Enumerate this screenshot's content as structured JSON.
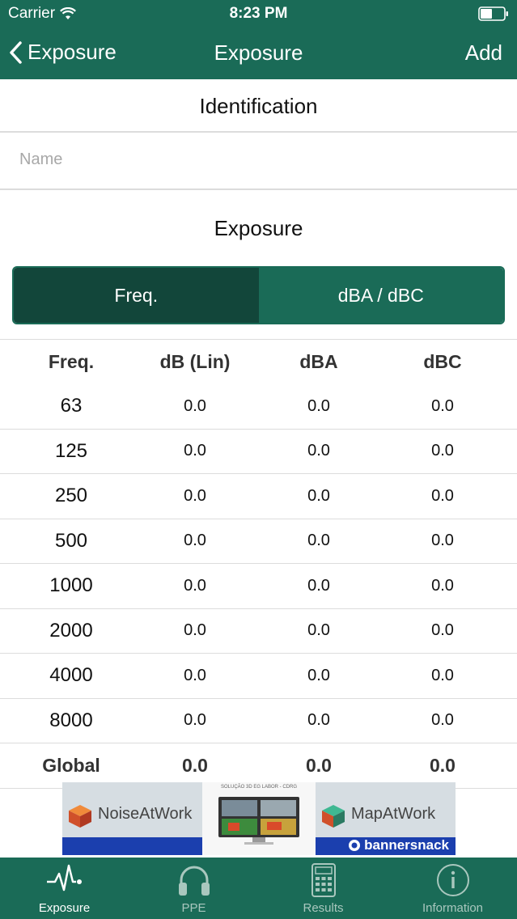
{
  "status_bar": {
    "carrier": "Carrier",
    "time": "8:23 PM"
  },
  "nav": {
    "back_label": "Exposure",
    "title": "Exposure",
    "add_label": "Add"
  },
  "identification": {
    "title": "Identification",
    "name_placeholder": "Name",
    "name_value": ""
  },
  "exposure": {
    "title": "Exposure",
    "segments": [
      {
        "label": "Freq.",
        "selected": true
      },
      {
        "label": "dBA / dBC",
        "selected": false
      }
    ]
  },
  "table": {
    "headers": [
      "Freq.",
      "dB (Lin)",
      "dBA",
      "dBC"
    ],
    "rows": [
      [
        "63",
        "0.0",
        "0.0",
        "0.0"
      ],
      [
        "125",
        "0.0",
        "0.0",
        "0.0"
      ],
      [
        "250",
        "0.0",
        "0.0",
        "0.0"
      ],
      [
        "500",
        "0.0",
        "0.0",
        "0.0"
      ],
      [
        "1000",
        "0.0",
        "0.0",
        "0.0"
      ],
      [
        "2000",
        "0.0",
        "0.0",
        "0.0"
      ],
      [
        "4000",
        "0.0",
        "0.0",
        "0.0"
      ],
      [
        "8000",
        "0.0",
        "0.0",
        "0.0"
      ]
    ],
    "global": [
      "Global",
      "0.0",
      "0.0",
      "0.0"
    ]
  },
  "banner": {
    "left_text": "NoiseAtWork",
    "middle_caption": "SOLUÇÃO 3D EG LABOR - CDRG",
    "right_text": "MapAtWork",
    "badge": "bannersnack"
  },
  "tabbar": {
    "items": [
      {
        "label": "Exposure",
        "icon": "waveform-icon",
        "selected": true
      },
      {
        "label": "PPE",
        "icon": "headphones-icon",
        "selected": false
      },
      {
        "label": "Results",
        "icon": "calculator-icon",
        "selected": false
      },
      {
        "label": "Information",
        "icon": "info-icon",
        "selected": false
      }
    ]
  },
  "colors": {
    "primary": "#1a6b57",
    "primary_dark": "#12463a",
    "separator": "#dcdcdc"
  }
}
